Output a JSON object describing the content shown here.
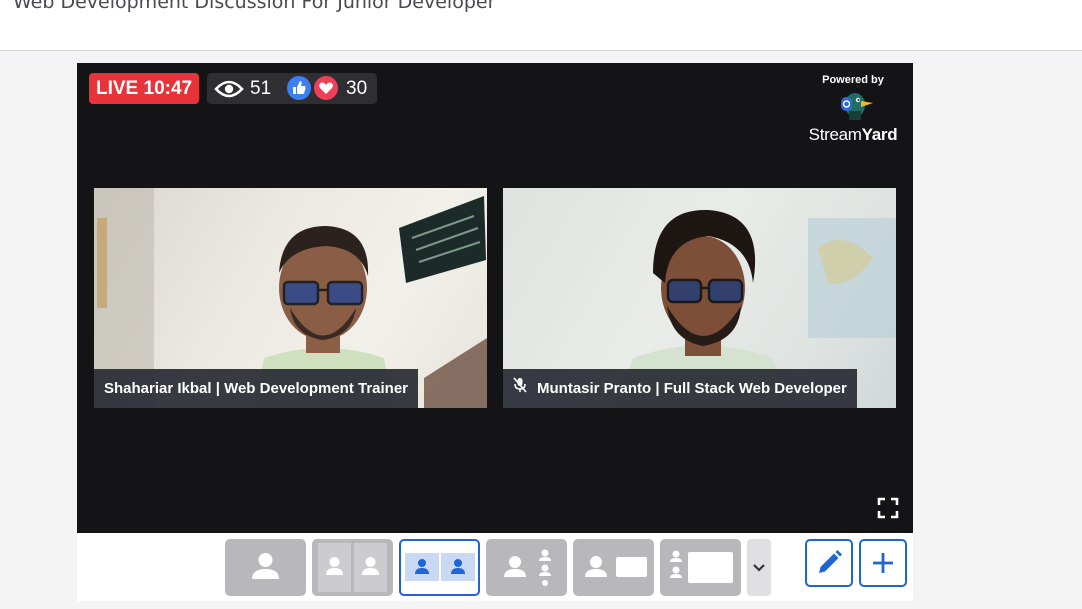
{
  "page": {
    "title": "Web Development Discussion For Junior Developer"
  },
  "stream": {
    "live_label": "LIVE 10:47",
    "viewer_count": "51",
    "reaction_count": "30",
    "powered_by": "Powered by",
    "brand_stream": "Stream",
    "brand_yard": "Yard"
  },
  "participants": [
    {
      "name_label": "Shahariar Ikbal | Web Development Trainer",
      "muted": false
    },
    {
      "name_label": "Muntasir Pranto | Full Stack Web Developer",
      "muted": true
    }
  ],
  "layouts": {
    "count": 6,
    "active_index": 2
  },
  "colors": {
    "live_red": "#e9333b",
    "accent_blue": "#1f65d6",
    "stage_bg": "#141416",
    "like_blue": "#3d7ef2",
    "heart_red": "#ee4058"
  }
}
